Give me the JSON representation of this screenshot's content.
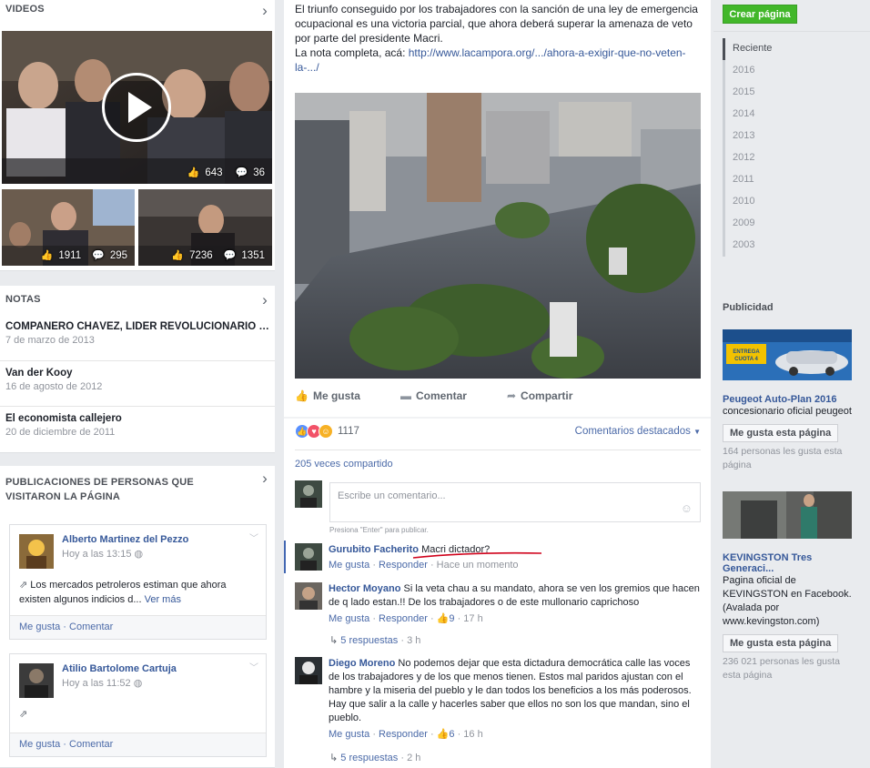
{
  "left": {
    "videos": {
      "title": "VIDEOS",
      "items": [
        {
          "likes": "643",
          "comments": "36"
        },
        {
          "likes": "1911",
          "comments": "295"
        },
        {
          "likes": "7236",
          "comments": "1351"
        }
      ]
    },
    "notes": {
      "title": "NOTAS",
      "items": [
        {
          "title": "COMPAÑERO CHÁVEZ, LÍDER REVOLUCIONARIO DEL ...",
          "date": "7 de marzo de 2013"
        },
        {
          "title": "Van der Kooy",
          "date": "16 de agosto de 2012"
        },
        {
          "title": "El economista callejero",
          "date": "20 de diciembre de 2011"
        }
      ]
    },
    "visitors": {
      "title": "PUBLICACIONES DE PERSONAS QUE VISITARON LA PÁGINA",
      "posts": [
        {
          "name": "Alberto Martinez del Pezzo",
          "time": "Hoy a las 13:15",
          "text": "Los mercados petroleros estiman que ahora existen algunos indicios d...",
          "more": "Ver más",
          "like": "Me gusta",
          "comment": "Comentar"
        },
        {
          "name": "Atilio Bartolome Cartuja",
          "time": "Hoy a las 11:52",
          "text": "",
          "more": "",
          "like": "Me gusta",
          "comment": "Comentar"
        }
      ]
    }
  },
  "post": {
    "text": "El triunfo conseguido por los trabajadores con la sanción de una ley de emergencia ocupacional es una victoria parcial, que ahora deberá superar la amenaza de veto por parte del presidente Macri.",
    "link_prefix": "La nota completa, acá: ",
    "link": "http://www.lacampora.org/.../ahora-a-exigir-que-no-veten-la-.../",
    "actions": {
      "like": "Me gusta",
      "comment": "Comentar",
      "share": "Compartir"
    },
    "reactions_count": "1117",
    "featured": "Comentarios destacados",
    "shares": "205 veces compartido",
    "comment_placeholder": "Escribe un comentario...",
    "enter_hint": "Presiona \"Enter\" para publicar.",
    "comments": [
      {
        "name": "Gurubito Facherito",
        "text": "Macri dictador?",
        "like": "Me gusta",
        "reply": "Responder",
        "time": "Hace un momento",
        "likes": "",
        "replies": ""
      },
      {
        "name": "Hector Moyano",
        "text": "Si la veta chau a su mandato, ahora se ven los gremios que hacen de q lado estan.!! De los trabajadores o de este mullonario caprichoso",
        "like": "Me gusta",
        "reply": "Responder",
        "time": "17 h",
        "likes": "9",
        "replies": "5 respuestas",
        "replies_time": "3 h"
      },
      {
        "name": "Diego Moreno",
        "text": "No podemos dejar que esta dictadura democrática calle las voces de los trabajadores y de los que menos tienen. Estos mal paridos ajustan con el hambre y la miseria del pueblo y le dan todos los beneficios a los más poderosos. Hay que salir a la calle y hacerles saber que ellos no son los que mandan, sino el pueblo.",
        "like": "Me gusta",
        "reply": "Responder",
        "time": "16 h",
        "likes": "6",
        "replies": "5 respuestas",
        "replies_time": "2 h"
      }
    ]
  },
  "right": {
    "create_page": "Crear página",
    "years": [
      "Reciente",
      "2016",
      "2015",
      "2014",
      "2013",
      "2012",
      "2011",
      "2010",
      "2009",
      "2003"
    ],
    "ads_title": "Publicidad",
    "ads": [
      {
        "title": "Peugeot Auto-Plan 2016",
        "text": "concesionario oficial peugeot",
        "like": "Me gusta esta página",
        "sub": "164 personas les gusta esta página",
        "img_text": "ENTREGA CUOTA 4"
      },
      {
        "title": "KEVINGSTON Tres Generaci...",
        "text": "Pagina oficial de KEVINGSTON en Facebook. (Avalada por www.kevingston.com)",
        "like": "Me gusta esta página",
        "sub": "236 021 personas les gusta esta página"
      }
    ]
  },
  "colors": {
    "accent": "#365899",
    "green": "#42b72a",
    "annotation": "#d0021b"
  }
}
